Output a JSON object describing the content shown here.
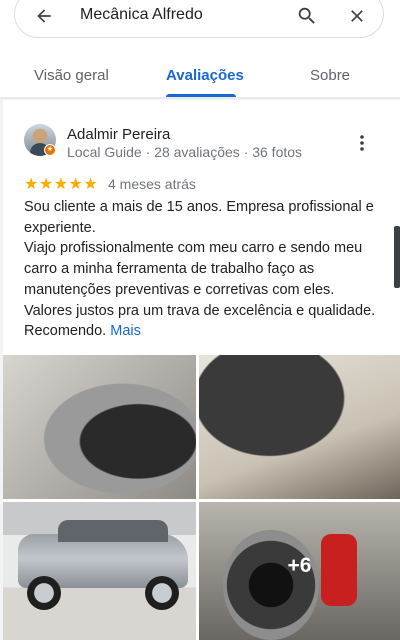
{
  "search": {
    "query": "Mecânica Alfredo",
    "back_icon": "arrow-back-icon",
    "search_icon": "search-icon",
    "close_icon": "close-icon"
  },
  "tabs": [
    {
      "label": "Visão geral",
      "active": false
    },
    {
      "label": "Avaliações",
      "active": true
    },
    {
      "label": "Sobre",
      "active": false
    }
  ],
  "review": {
    "author": "Adalmir Pereira",
    "meta": "Local Guide · 28 avaliações · 36 fotos",
    "rating": 5,
    "stars": "★★★★★",
    "date": "4 meses atrás",
    "paragraphs": [
      "Sou cliente a mais de 15 anos. Empresa profissional e experiente.",
      "Viajo profissionalmente com meu carro e sendo meu carro a minha ferramenta de trabalho faço as manutenções preventivas e corretivas com eles.",
      "Valores justos pra um trava de excelência e qualidade. Recomendo."
    ],
    "more_label": "Mais",
    "more_icon": "more-vert-icon",
    "extra_photos_label": "+6"
  },
  "colors": {
    "accent": "#1967d2",
    "stars": "#f9ab00",
    "guide_badge": "#e37400"
  }
}
